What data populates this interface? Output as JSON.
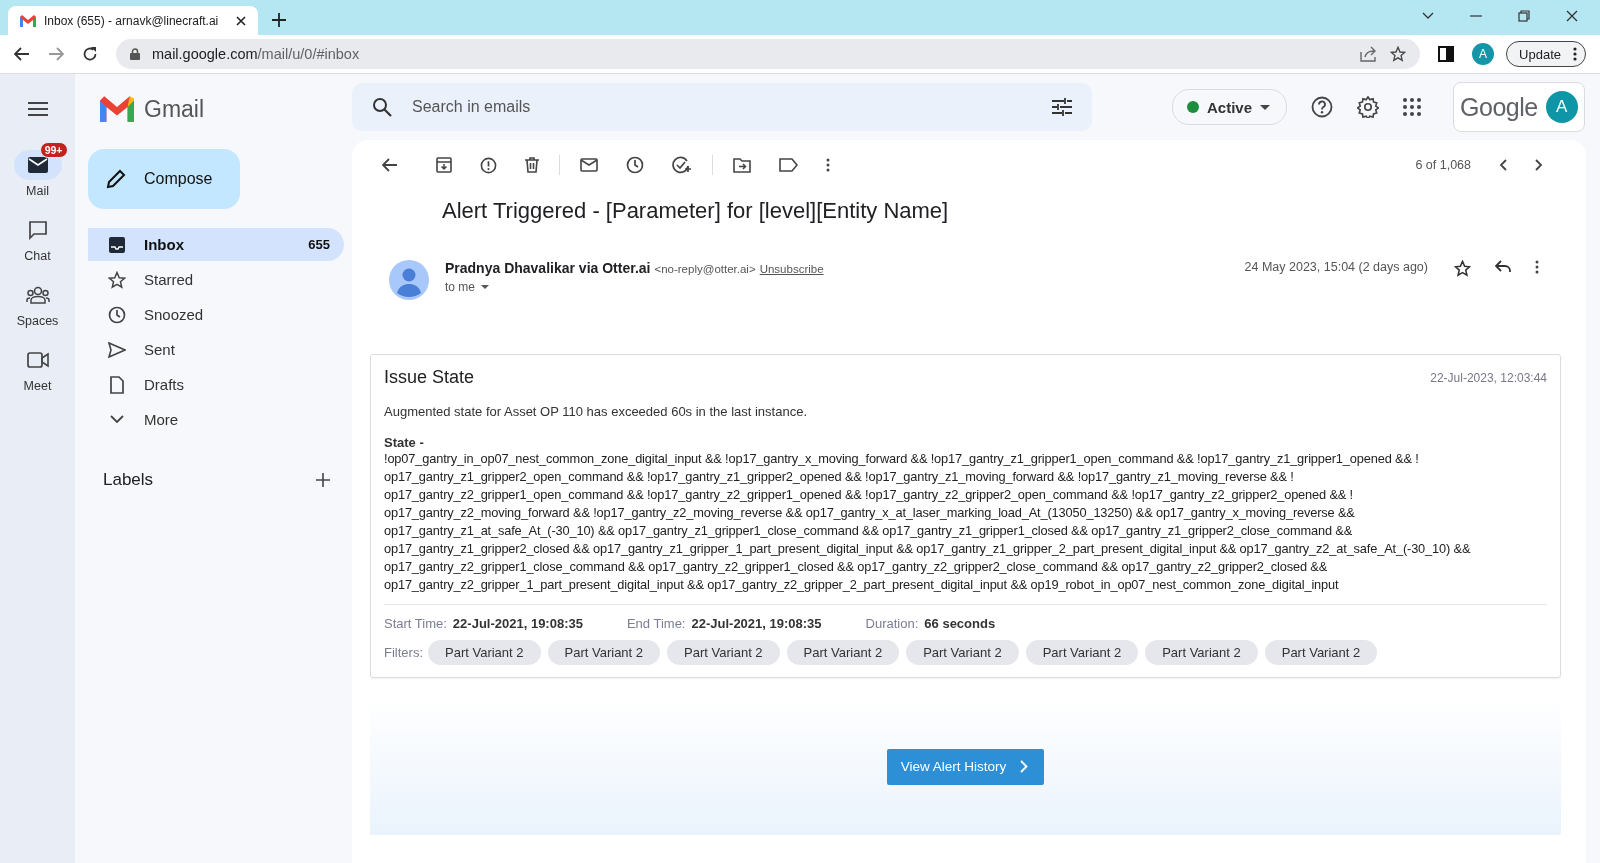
{
  "browser": {
    "tab_title": "Inbox (655) - arnavk@linecraft.ai",
    "url_host": "mail.google.com",
    "url_path": "/mail/u/0/#inbox",
    "profile_initial": "A",
    "update_label": "Update"
  },
  "app": {
    "name": "Gmail",
    "search_placeholder": "Search in emails",
    "status": "Active",
    "google_label": "Google",
    "avatar_initial": "A"
  },
  "rail": [
    {
      "label": "Mail",
      "selected": true,
      "badge": "99+",
      "kind": "mail"
    },
    {
      "label": "Chat",
      "selected": false,
      "kind": "chat"
    },
    {
      "label": "Spaces",
      "selected": false,
      "kind": "spaces"
    },
    {
      "label": "Meet",
      "selected": false,
      "kind": "meet"
    }
  ],
  "compose": "Compose",
  "nav": [
    {
      "label": "Inbox",
      "count": "655",
      "selected": true,
      "kind": "inbox"
    },
    {
      "label": "Starred",
      "selected": false,
      "kind": "star"
    },
    {
      "label": "Snoozed",
      "selected": false,
      "kind": "clock"
    },
    {
      "label": "Sent",
      "selected": false,
      "kind": "send"
    },
    {
      "label": "Drafts",
      "selected": false,
      "kind": "draft"
    },
    {
      "label": "More",
      "selected": false,
      "kind": "more"
    }
  ],
  "labels_heading": "Labels",
  "pager": "6 of 1,068",
  "email": {
    "subject": "Alert Triggered - [Parameter] for [level][Entity Name]",
    "sender": "Pradnya Dhavalikar via Otter.ai",
    "sender_email": "<no-reply@otter.ai>",
    "unsubscribe": "Unsubscribe",
    "recipient": "to me",
    "date": "24 May 2023, 15:04 (2 days ago)"
  },
  "alert": {
    "title": "Issue State",
    "timestamp": "22-Jul-2023, 12:03:44",
    "summary": "Augmented state for Asset OP 110 has exceeded 60s in the last instance.",
    "state_label": "State -",
    "state_lines": [
      "!op07_gantry_in_op07_nest_common_zone_digital_input && !op17_gantry_x_moving_forward && !op17_gantry_z1_gripper1_open_command && !op17_gantry_z1_gripper1_opened && !",
      "op17_gantry_z1_gripper2_open_command && !op17_gantry_z1_gripper2_opened && !op17_gantry_z1_moving_forward && !op17_gantry_z1_moving_reverse && !",
      "op17_gantry_z2_gripper1_open_command && !op17_gantry_z2_gripper1_opened && !op17_gantry_z2_gripper2_open_command && !op17_gantry_z2_gripper2_opened && !",
      "op17_gantry_z2_moving_forward && !op17_gantry_z2_moving_reverse && op17_gantry_x_at_laser_marking_load_At_(13050_13250) && op17_gantry_x_moving_reverse &&",
      "op17_gantry_z1_at_safe_At_(-30_10) && op17_gantry_z1_gripper1_close_command && op17_gantry_z1_gripper1_closed && op17_gantry_z1_gripper2_close_command &&",
      "op17_gantry_z1_gripper2_closed && op17_gantry_z1_gripper_1_part_present_digital_input && op17_gantry_z1_gripper_2_part_present_digital_input && op17_gantry_z2_at_safe_At_(-30_10) &&",
      "op17_gantry_z2_gripper1_close_command && op17_gantry_z2_gripper1_closed && op17_gantry_z2_gripper2_close_command && op17_gantry_z2_gripper2_closed &&",
      "op17_gantry_z2_gripper_1_part_present_digital_input && op17_gantry_z2_gripper_2_part_present_digital_input && op19_robot_in_op07_nest_common_zone_digital_input"
    ],
    "meta": [
      {
        "label": "Start Time:",
        "value": "22-Jul-2021, 19:08:35"
      },
      {
        "label": "End Time:",
        "value": "22-Jul-2021, 19:08:35"
      },
      {
        "label": "Duration:",
        "value": "66 seconds"
      }
    ],
    "filters_label": "Filters:",
    "filters": [
      "Part Variant 2",
      "Part Variant 2",
      "Part Variant 2",
      "Part Variant 2",
      "Part Variant 2",
      "Part Variant 2",
      "Part Variant 2",
      "Part Variant 2"
    ],
    "button": "View Alert History"
  }
}
